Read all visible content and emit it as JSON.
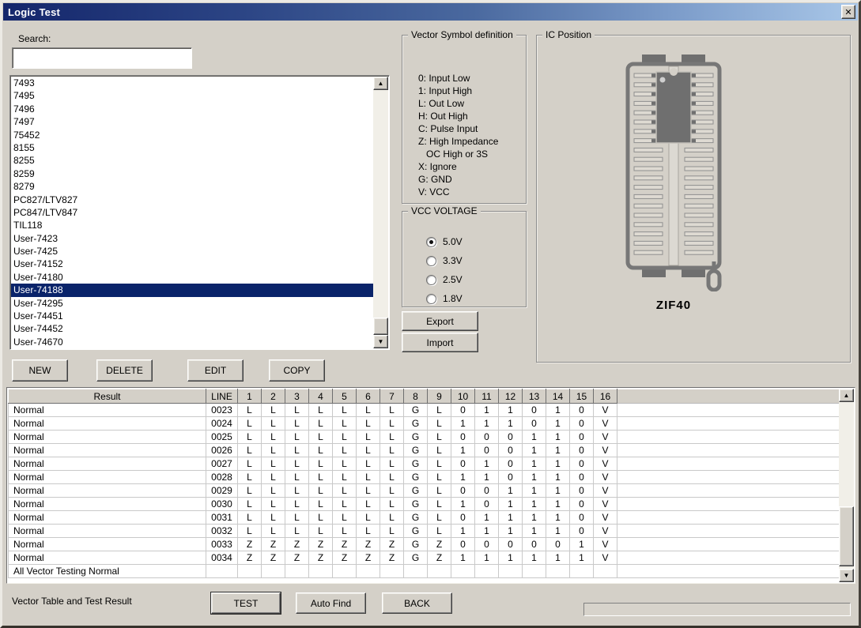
{
  "window": {
    "title": "Logic Test",
    "close_label": "✕"
  },
  "colors": {
    "titlebar_start": "#14266b",
    "titlebar_end": "#a9c7e8",
    "selection": "#0a246a",
    "face": "#d4d0c8"
  },
  "search": {
    "label": "Search:",
    "value": ""
  },
  "device_list": {
    "items": [
      "7493",
      "7495",
      "7496",
      "7497",
      "75452",
      "8155",
      "8255",
      "8259",
      "8279",
      "PC827/LTV827",
      "PC847/LTV847",
      "TIL118",
      "User-7423",
      "User-7425",
      "User-74152",
      "User-74180",
      "User-74188",
      "User-74295",
      "User-74451",
      "User-74452",
      "User-74670"
    ],
    "selected": "User-74188"
  },
  "list_buttons": {
    "new": "NEW",
    "delete": "DELETE",
    "edit": "EDIT",
    "copy": "COPY"
  },
  "vector_symbols": {
    "title": "Vector Symbol definition",
    "lines": [
      "0: Input Low",
      "1: Input High",
      "L: Out Low",
      "H: Out High",
      "C: Pulse Input",
      "Z: High Impedance",
      "   OC High or 3S",
      "X: Ignore",
      "G: GND",
      "V: VCC"
    ]
  },
  "vcc_voltage": {
    "title": "VCC VOLTAGE",
    "options": [
      {
        "label": "5.0V",
        "selected": true
      },
      {
        "label": "3.3V",
        "selected": false
      },
      {
        "label": "2.5V",
        "selected": false
      },
      {
        "label": "1.8V",
        "selected": false
      }
    ]
  },
  "io_buttons": {
    "export": "Export",
    "import": "Import"
  },
  "ic_position": {
    "title": "IC Position",
    "socket_label": "ZIF40"
  },
  "result_table": {
    "headers": [
      "Result",
      "LINE",
      "1",
      "2",
      "3",
      "4",
      "5",
      "6",
      "7",
      "8",
      "9",
      "10",
      "11",
      "12",
      "13",
      "14",
      "15",
      "16"
    ],
    "rows": [
      {
        "result": "Normal",
        "line": "0023",
        "pins": [
          "L",
          "L",
          "L",
          "L",
          "L",
          "L",
          "L",
          "G",
          "L",
          "0",
          "1",
          "1",
          "0",
          "1",
          "0",
          "V"
        ]
      },
      {
        "result": "Normal",
        "line": "0024",
        "pins": [
          "L",
          "L",
          "L",
          "L",
          "L",
          "L",
          "L",
          "G",
          "L",
          "1",
          "1",
          "1",
          "0",
          "1",
          "0",
          "V"
        ]
      },
      {
        "result": "Normal",
        "line": "0025",
        "pins": [
          "L",
          "L",
          "L",
          "L",
          "L",
          "L",
          "L",
          "G",
          "L",
          "0",
          "0",
          "0",
          "1",
          "1",
          "0",
          "V"
        ]
      },
      {
        "result": "Normal",
        "line": "0026",
        "pins": [
          "L",
          "L",
          "L",
          "L",
          "L",
          "L",
          "L",
          "G",
          "L",
          "1",
          "0",
          "0",
          "1",
          "1",
          "0",
          "V"
        ]
      },
      {
        "result": "Normal",
        "line": "0027",
        "pins": [
          "L",
          "L",
          "L",
          "L",
          "L",
          "L",
          "L",
          "G",
          "L",
          "0",
          "1",
          "0",
          "1",
          "1",
          "0",
          "V"
        ]
      },
      {
        "result": "Normal",
        "line": "0028",
        "pins": [
          "L",
          "L",
          "L",
          "L",
          "L",
          "L",
          "L",
          "G",
          "L",
          "1",
          "1",
          "0",
          "1",
          "1",
          "0",
          "V"
        ]
      },
      {
        "result": "Normal",
        "line": "0029",
        "pins": [
          "L",
          "L",
          "L",
          "L",
          "L",
          "L",
          "L",
          "G",
          "L",
          "0",
          "0",
          "1",
          "1",
          "1",
          "0",
          "V"
        ]
      },
      {
        "result": "Normal",
        "line": "0030",
        "pins": [
          "L",
          "L",
          "L",
          "L",
          "L",
          "L",
          "L",
          "G",
          "L",
          "1",
          "0",
          "1",
          "1",
          "1",
          "0",
          "V"
        ]
      },
      {
        "result": "Normal",
        "line": "0031",
        "pins": [
          "L",
          "L",
          "L",
          "L",
          "L",
          "L",
          "L",
          "G",
          "L",
          "0",
          "1",
          "1",
          "1",
          "1",
          "0",
          "V"
        ]
      },
      {
        "result": "Normal",
        "line": "0032",
        "pins": [
          "L",
          "L",
          "L",
          "L",
          "L",
          "L",
          "L",
          "G",
          "L",
          "1",
          "1",
          "1",
          "1",
          "1",
          "0",
          "V"
        ]
      },
      {
        "result": "Normal",
        "line": "0033",
        "pins": [
          "Z",
          "Z",
          "Z",
          "Z",
          "Z",
          "Z",
          "Z",
          "G",
          "Z",
          "0",
          "0",
          "0",
          "0",
          "0",
          "1",
          "V"
        ]
      },
      {
        "result": "Normal",
        "line": "0034",
        "pins": [
          "Z",
          "Z",
          "Z",
          "Z",
          "Z",
          "Z",
          "Z",
          "G",
          "Z",
          "1",
          "1",
          "1",
          "1",
          "1",
          "1",
          "V"
        ]
      }
    ],
    "footer": "All Vector Testing Normal"
  },
  "bottom": {
    "status_label": "Vector Table and Test Result",
    "test": "TEST",
    "auto_find": "Auto Find",
    "back": "BACK"
  }
}
